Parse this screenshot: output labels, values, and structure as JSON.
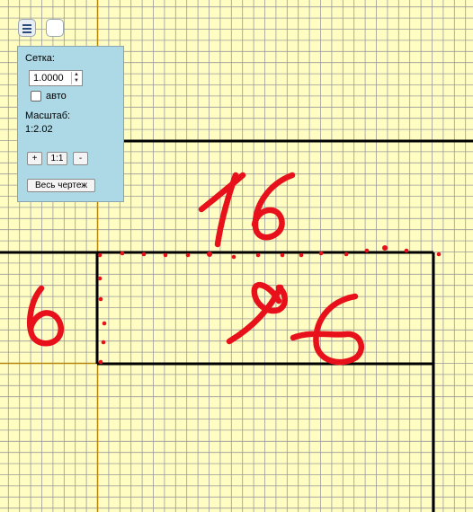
{
  "colors": {
    "paper": "#FFFDC2",
    "grid_line": "#9A9A9A",
    "axis_line": "#B8860B",
    "drawing_line": "#000000",
    "annotation": "#E8101A",
    "panel": "#ADD8E6"
  },
  "toolbar": {
    "menu_icon": "hamburger-icon",
    "blank_icon": "blank-square-icon"
  },
  "panel": {
    "grid_label": "Сетка:",
    "grid_value": "1.0000",
    "auto_checked": false,
    "auto_label": "авто",
    "scale_label": "Масштаб:",
    "scale_value": "1:2.02",
    "zoom_in_label": "+",
    "zoom_reset_label": "1:1",
    "zoom_out_label": "-",
    "fit_all_label": "Весь чертеж"
  },
  "annotations": {
    "top_dimension": "16",
    "left_dimension": "6",
    "right_dimension": "96"
  }
}
